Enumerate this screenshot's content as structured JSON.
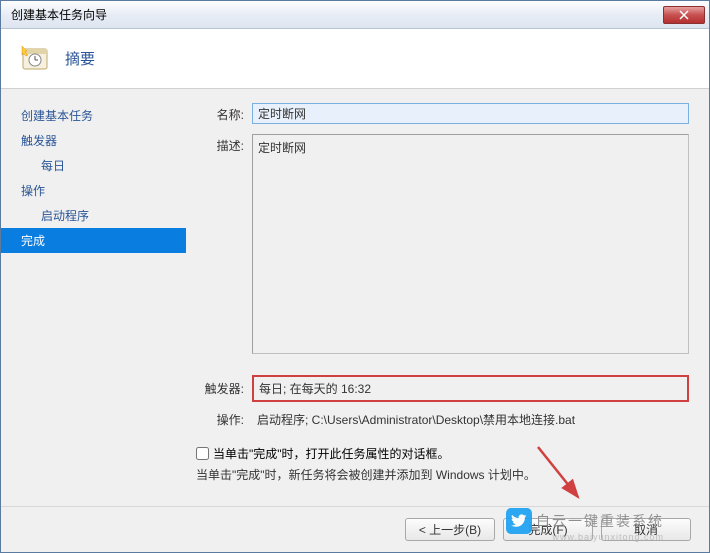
{
  "window": {
    "title": "创建基本任务向导"
  },
  "header": {
    "title": "摘要"
  },
  "sidebar": {
    "items": [
      {
        "label": "创建基本任务",
        "indent": false,
        "selected": false
      },
      {
        "label": "触发器",
        "indent": false,
        "selected": false
      },
      {
        "label": "每日",
        "indent": true,
        "selected": false
      },
      {
        "label": "操作",
        "indent": false,
        "selected": false
      },
      {
        "label": "启动程序",
        "indent": true,
        "selected": false
      },
      {
        "label": "完成",
        "indent": false,
        "selected": true
      }
    ]
  },
  "form": {
    "name_label": "名称:",
    "name_value": "定时断网",
    "desc_label": "描述:",
    "desc_value": "定时断网"
  },
  "summary": {
    "trigger_label": "触发器:",
    "trigger_value": "每日; 在每天的 16:32",
    "action_label": "操作:",
    "action_value": "启动程序; C:\\Users\\Administrator\\Desktop\\禁用本地连接.bat"
  },
  "checkbox": {
    "label": "当单击\"完成\"时，打开此任务属性的对话框。"
  },
  "info": {
    "text": "当单击\"完成\"时，新任务将会被创建并添加到 Windows 计划中。"
  },
  "buttons": {
    "back": "< 上一步(B)",
    "finish": "完成(F)",
    "cancel": "取消"
  },
  "watermark": {
    "text": "白云一键重装系统",
    "url": "www.baiyunxitong.com"
  }
}
